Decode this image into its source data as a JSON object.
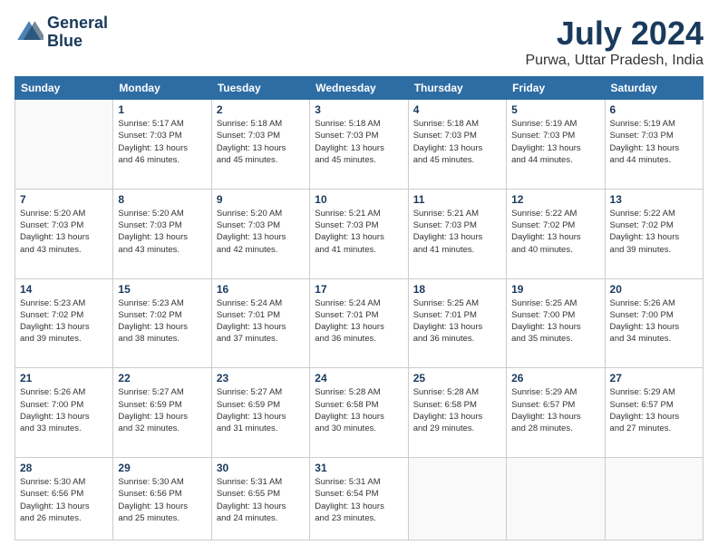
{
  "header": {
    "logo_line1": "General",
    "logo_line2": "Blue",
    "month_year": "July 2024",
    "location": "Purwa, Uttar Pradesh, India"
  },
  "weekdays": [
    "Sunday",
    "Monday",
    "Tuesday",
    "Wednesday",
    "Thursday",
    "Friday",
    "Saturday"
  ],
  "weeks": [
    [
      {
        "day": "",
        "info": ""
      },
      {
        "day": "1",
        "info": "Sunrise: 5:17 AM\nSunset: 7:03 PM\nDaylight: 13 hours\nand 46 minutes."
      },
      {
        "day": "2",
        "info": "Sunrise: 5:18 AM\nSunset: 7:03 PM\nDaylight: 13 hours\nand 45 minutes."
      },
      {
        "day": "3",
        "info": "Sunrise: 5:18 AM\nSunset: 7:03 PM\nDaylight: 13 hours\nand 45 minutes."
      },
      {
        "day": "4",
        "info": "Sunrise: 5:18 AM\nSunset: 7:03 PM\nDaylight: 13 hours\nand 45 minutes."
      },
      {
        "day": "5",
        "info": "Sunrise: 5:19 AM\nSunset: 7:03 PM\nDaylight: 13 hours\nand 44 minutes."
      },
      {
        "day": "6",
        "info": "Sunrise: 5:19 AM\nSunset: 7:03 PM\nDaylight: 13 hours\nand 44 minutes."
      }
    ],
    [
      {
        "day": "7",
        "info": "Sunrise: 5:20 AM\nSunset: 7:03 PM\nDaylight: 13 hours\nand 43 minutes."
      },
      {
        "day": "8",
        "info": "Sunrise: 5:20 AM\nSunset: 7:03 PM\nDaylight: 13 hours\nand 43 minutes."
      },
      {
        "day": "9",
        "info": "Sunrise: 5:20 AM\nSunset: 7:03 PM\nDaylight: 13 hours\nand 42 minutes."
      },
      {
        "day": "10",
        "info": "Sunrise: 5:21 AM\nSunset: 7:03 PM\nDaylight: 13 hours\nand 41 minutes."
      },
      {
        "day": "11",
        "info": "Sunrise: 5:21 AM\nSunset: 7:03 PM\nDaylight: 13 hours\nand 41 minutes."
      },
      {
        "day": "12",
        "info": "Sunrise: 5:22 AM\nSunset: 7:02 PM\nDaylight: 13 hours\nand 40 minutes."
      },
      {
        "day": "13",
        "info": "Sunrise: 5:22 AM\nSunset: 7:02 PM\nDaylight: 13 hours\nand 39 minutes."
      }
    ],
    [
      {
        "day": "14",
        "info": "Sunrise: 5:23 AM\nSunset: 7:02 PM\nDaylight: 13 hours\nand 39 minutes."
      },
      {
        "day": "15",
        "info": "Sunrise: 5:23 AM\nSunset: 7:02 PM\nDaylight: 13 hours\nand 38 minutes."
      },
      {
        "day": "16",
        "info": "Sunrise: 5:24 AM\nSunset: 7:01 PM\nDaylight: 13 hours\nand 37 minutes."
      },
      {
        "day": "17",
        "info": "Sunrise: 5:24 AM\nSunset: 7:01 PM\nDaylight: 13 hours\nand 36 minutes."
      },
      {
        "day": "18",
        "info": "Sunrise: 5:25 AM\nSunset: 7:01 PM\nDaylight: 13 hours\nand 36 minutes."
      },
      {
        "day": "19",
        "info": "Sunrise: 5:25 AM\nSunset: 7:00 PM\nDaylight: 13 hours\nand 35 minutes."
      },
      {
        "day": "20",
        "info": "Sunrise: 5:26 AM\nSunset: 7:00 PM\nDaylight: 13 hours\nand 34 minutes."
      }
    ],
    [
      {
        "day": "21",
        "info": "Sunrise: 5:26 AM\nSunset: 7:00 PM\nDaylight: 13 hours\nand 33 minutes."
      },
      {
        "day": "22",
        "info": "Sunrise: 5:27 AM\nSunset: 6:59 PM\nDaylight: 13 hours\nand 32 minutes."
      },
      {
        "day": "23",
        "info": "Sunrise: 5:27 AM\nSunset: 6:59 PM\nDaylight: 13 hours\nand 31 minutes."
      },
      {
        "day": "24",
        "info": "Sunrise: 5:28 AM\nSunset: 6:58 PM\nDaylight: 13 hours\nand 30 minutes."
      },
      {
        "day": "25",
        "info": "Sunrise: 5:28 AM\nSunset: 6:58 PM\nDaylight: 13 hours\nand 29 minutes."
      },
      {
        "day": "26",
        "info": "Sunrise: 5:29 AM\nSunset: 6:57 PM\nDaylight: 13 hours\nand 28 minutes."
      },
      {
        "day": "27",
        "info": "Sunrise: 5:29 AM\nSunset: 6:57 PM\nDaylight: 13 hours\nand 27 minutes."
      }
    ],
    [
      {
        "day": "28",
        "info": "Sunrise: 5:30 AM\nSunset: 6:56 PM\nDaylight: 13 hours\nand 26 minutes."
      },
      {
        "day": "29",
        "info": "Sunrise: 5:30 AM\nSunset: 6:56 PM\nDaylight: 13 hours\nand 25 minutes."
      },
      {
        "day": "30",
        "info": "Sunrise: 5:31 AM\nSunset: 6:55 PM\nDaylight: 13 hours\nand 24 minutes."
      },
      {
        "day": "31",
        "info": "Sunrise: 5:31 AM\nSunset: 6:54 PM\nDaylight: 13 hours\nand 23 minutes."
      },
      {
        "day": "",
        "info": ""
      },
      {
        "day": "",
        "info": ""
      },
      {
        "day": "",
        "info": ""
      }
    ]
  ]
}
